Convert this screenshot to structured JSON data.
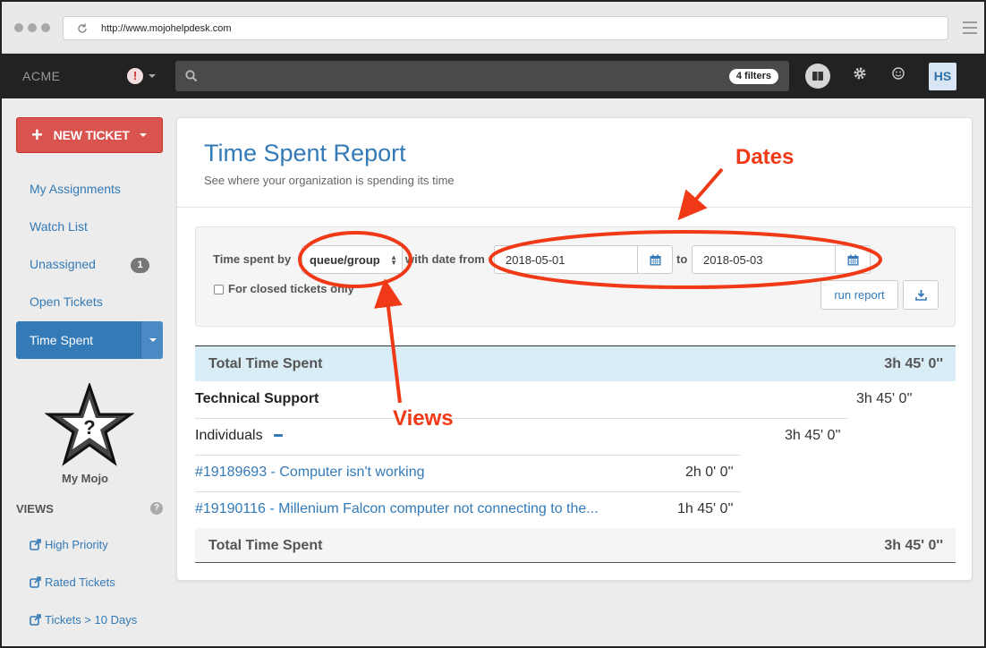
{
  "browser": {
    "url": "http://www.mojohelpdesk.com"
  },
  "topnav": {
    "brand": "ACME",
    "alert_symbol": "!",
    "search_placeholder": "",
    "filters_label": "4 filters",
    "avatar_initials": "HS"
  },
  "sidebar": {
    "new_ticket_label": "NEW TICKET",
    "links": {
      "my_assignments": "My Assignments",
      "watch_list": "Watch List",
      "unassigned": "Unassigned",
      "unassigned_count": "1",
      "open_tickets": "Open Tickets",
      "time_spent": "Time Spent"
    },
    "mojo_label": "My Mojo",
    "views_title": "VIEWS",
    "views": [
      "High Priority",
      "Rated Tickets",
      "Tickets > 10 Days"
    ]
  },
  "report": {
    "title": "Time Spent Report",
    "subtitle": "See where your organization is spending its time",
    "filters": {
      "time_spent_by_label": "Time spent by",
      "group_by_value": "queue/group",
      "with_date_from_label": "with date from",
      "date_from": "2018-05-01",
      "to_label": "to",
      "date_to": "2018-05-03",
      "closed_only_label": "For closed tickets only",
      "run_report_label": "run report"
    },
    "rows": {
      "total_top_label": "Total Time Spent",
      "total_top_value": "3h 45' 0''",
      "group_label": "Technical Support",
      "group_value": "3h 45' 0''",
      "individuals_label": "Individuals",
      "individuals_value": "3h 45' 0''",
      "tickets": [
        {
          "label": "#19189693 - Computer isn't working",
          "value": "2h 0' 0''"
        },
        {
          "label": "#19190116 - Millenium Falcon computer not connecting to the...",
          "value": "1h 45' 0''"
        }
      ],
      "total_bottom_label": "Total Time Spent",
      "total_bottom_value": "3h 45' 0''"
    }
  },
  "annotations": {
    "dates_label": "Dates",
    "views_label": "Views",
    "color": "#f03a17"
  }
}
